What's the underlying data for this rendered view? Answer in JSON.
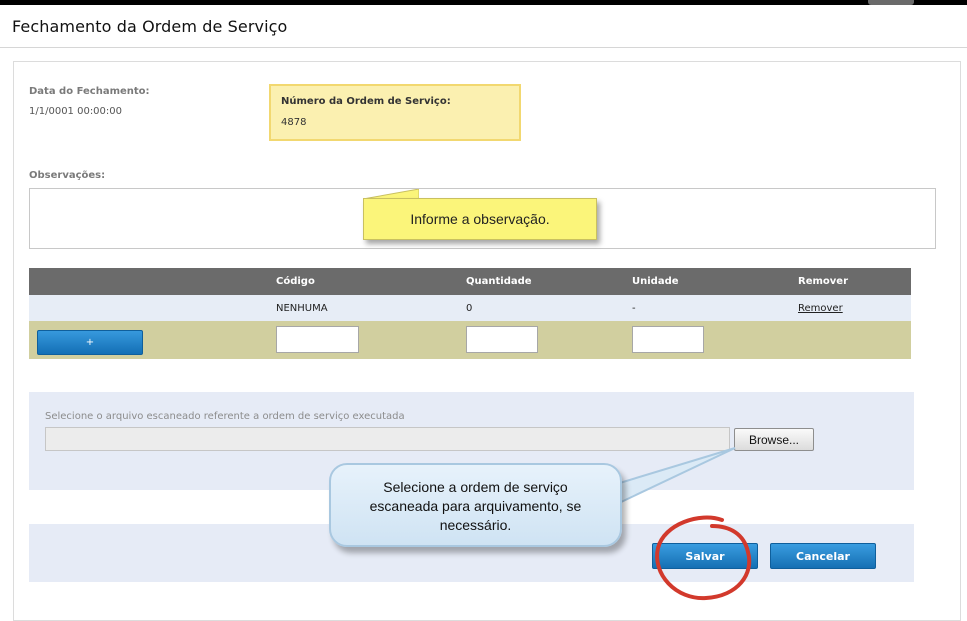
{
  "page": {
    "title": "Fechamento da Ordem de Serviço"
  },
  "fechamento": {
    "label": "Data do Fechamento:",
    "value": "1/1/0001 00:00:00"
  },
  "ordem": {
    "label": "Número da Ordem de Serviço:",
    "value": "4878"
  },
  "observacoes": {
    "label": "Observações:",
    "tooltip": "Informe a observação."
  },
  "table": {
    "headers": [
      "",
      "Código",
      "Quantidade",
      "Unidade",
      "Remover"
    ],
    "row": {
      "codigo": "NENHUMA",
      "quantidade": "0",
      "unidade": "-",
      "remover": "Remover"
    },
    "add_label": "+"
  },
  "file": {
    "label": "Selecione o arquivo escaneado referente a ordem de serviço executada",
    "browse_label": "Browse...",
    "tooltip": "Selecione a ordem de serviço escaneada para arquivamento, se necessário."
  },
  "actions": {
    "save_label": "Salvar",
    "cancel_label": "Cancelar"
  },
  "colors": {
    "header_bar": "#6b6b6b",
    "row_bg": "#e7edf6",
    "add_row_bg": "#d1cf9f",
    "button_blue": "#1f84c8",
    "highlight_box": "#fbf0b0",
    "tooltip_yellow": "#fbf57a",
    "annotation_red": "#d2392c"
  }
}
